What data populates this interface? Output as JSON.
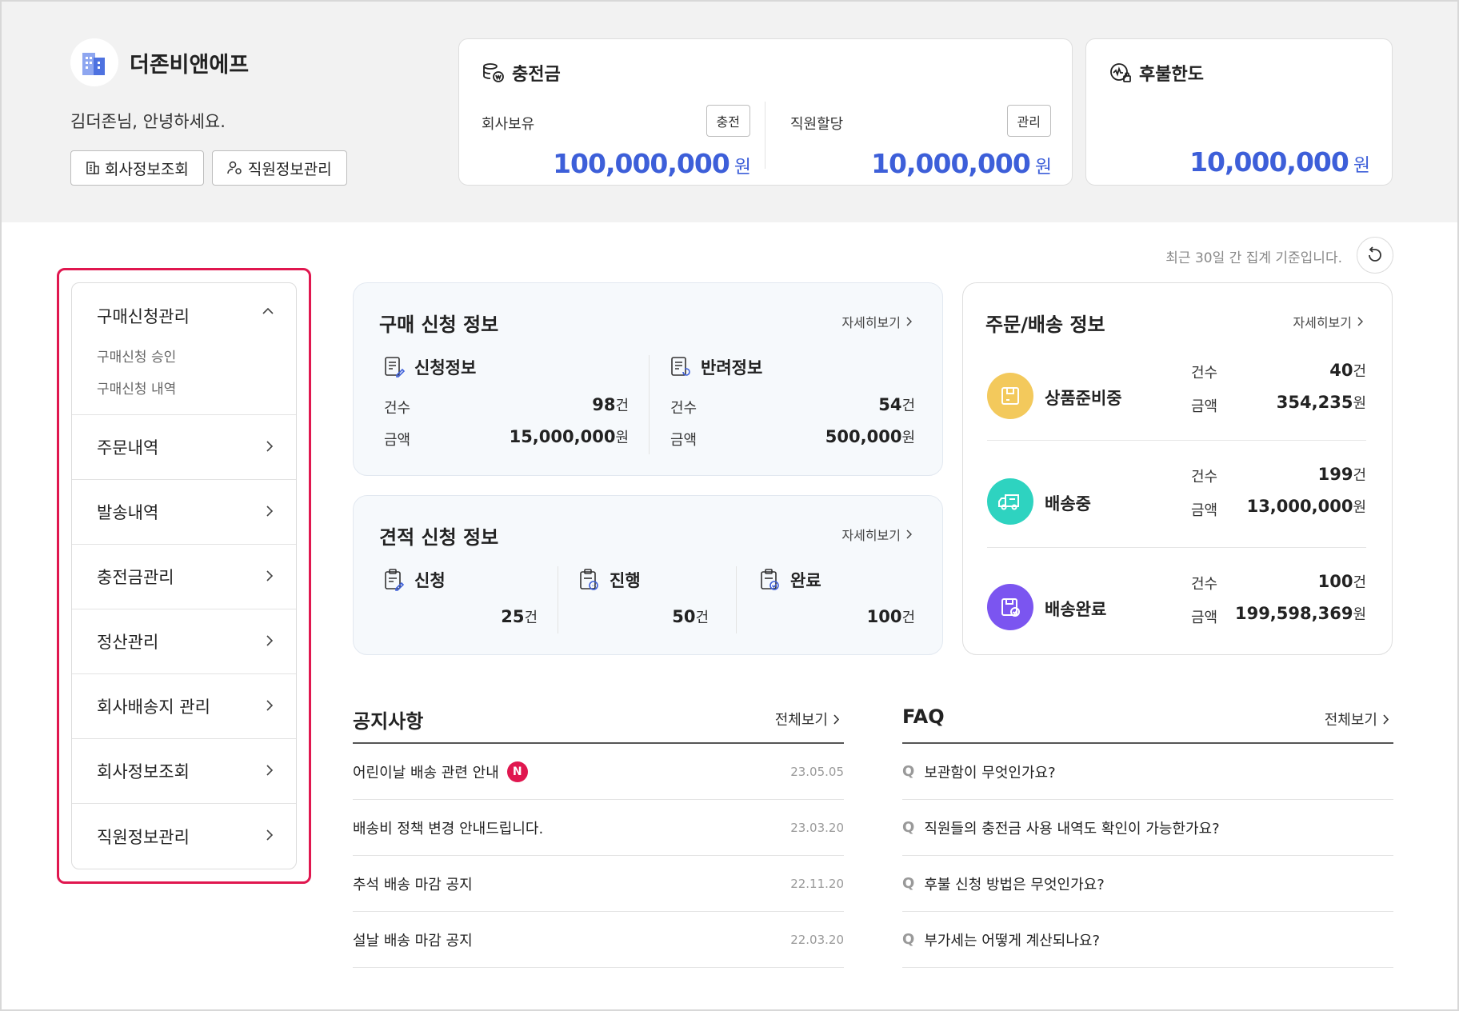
{
  "company": {
    "name": "더존비앤에프",
    "greeting": "김더존님, 안녕하세요.",
    "buttons": [
      "회사정보조회",
      "직원정보관리"
    ]
  },
  "charge": {
    "title": "충전금",
    "company_label": "회사보유",
    "company_button": "충전",
    "company_amount": "100,000,000",
    "employee_label": "직원할당",
    "employee_button": "관리",
    "employee_amount": "10,000,000",
    "currency": "원"
  },
  "deferred": {
    "title": "후불한도",
    "amount": "10,000,000",
    "currency": "원"
  },
  "period_note": "최근 30일 간 집계 기준입니다.",
  "menu": {
    "group_title": "구매신청관리",
    "sub_items": [
      "구매신청 승인",
      "구매신청 내역"
    ],
    "items": [
      "주문내역",
      "발송내역",
      "충전금관리",
      "정산관리",
      "회사배송지 관리",
      "회사정보조회",
      "직원정보관리"
    ]
  },
  "purchase": {
    "title": "구매 신청 정보",
    "more": "자세히보기",
    "count_label": "건수",
    "amount_label": "금액",
    "left": {
      "title": "신청정보",
      "count": "98",
      "count_unit": "건",
      "amount": "15,000,000",
      "amount_unit": "원"
    },
    "right": {
      "title": "반려정보",
      "count": "54",
      "count_unit": "건",
      "amount": "500,000",
      "amount_unit": "원"
    }
  },
  "estimate": {
    "title": "견적 신청 정보",
    "more": "자세히보기",
    "items": [
      {
        "label": "신청",
        "count": "25",
        "unit": "건"
      },
      {
        "label": "진행",
        "count": "50",
        "unit": "건"
      },
      {
        "label": "완료",
        "count": "100",
        "unit": "건"
      }
    ]
  },
  "orders": {
    "title": "주문/배송 정보",
    "more": "자세히보기",
    "count_label": "건수",
    "amount_label": "금액",
    "rows": [
      {
        "name": "상품준비중",
        "count": "40",
        "count_unit": "건",
        "amount": "354,235",
        "amount_unit": "원",
        "color": "#f3c95c"
      },
      {
        "name": "배송중",
        "count": "199",
        "count_unit": "건",
        "amount": "13,000,000",
        "amount_unit": "원",
        "color": "#2ed3c0"
      },
      {
        "name": "배송완료",
        "count": "100",
        "count_unit": "건",
        "amount": "199,598,369",
        "amount_unit": "원",
        "color": "#7b55f0"
      }
    ]
  },
  "notice": {
    "title": "공지사항",
    "more": "전체보기",
    "new_badge": "N",
    "rows": [
      {
        "title": "어린이날 배송 관련 안내",
        "date": "23.05.05"
      },
      {
        "title": "배송비 정책 변경 안내드립니다.",
        "date": "23.03.20"
      },
      {
        "title": "추석 배송 마감 공지",
        "date": "22.11.20"
      },
      {
        "title": "설날 배송 마감 공지",
        "date": "22.03.20"
      }
    ]
  },
  "faq": {
    "title": "FAQ",
    "more": "전체보기",
    "q_mark": "Q",
    "rows": [
      "보관함이 무엇인가요?",
      "직원들의 충전금 사용 내역도 확인이 가능한가요?",
      "후불 신청 방법은 무엇인가요?",
      "부가세는 어떻게 계산되나요?"
    ]
  },
  "colors": {
    "accent": "#3d5fd9",
    "highlight": "#e0174f"
  }
}
